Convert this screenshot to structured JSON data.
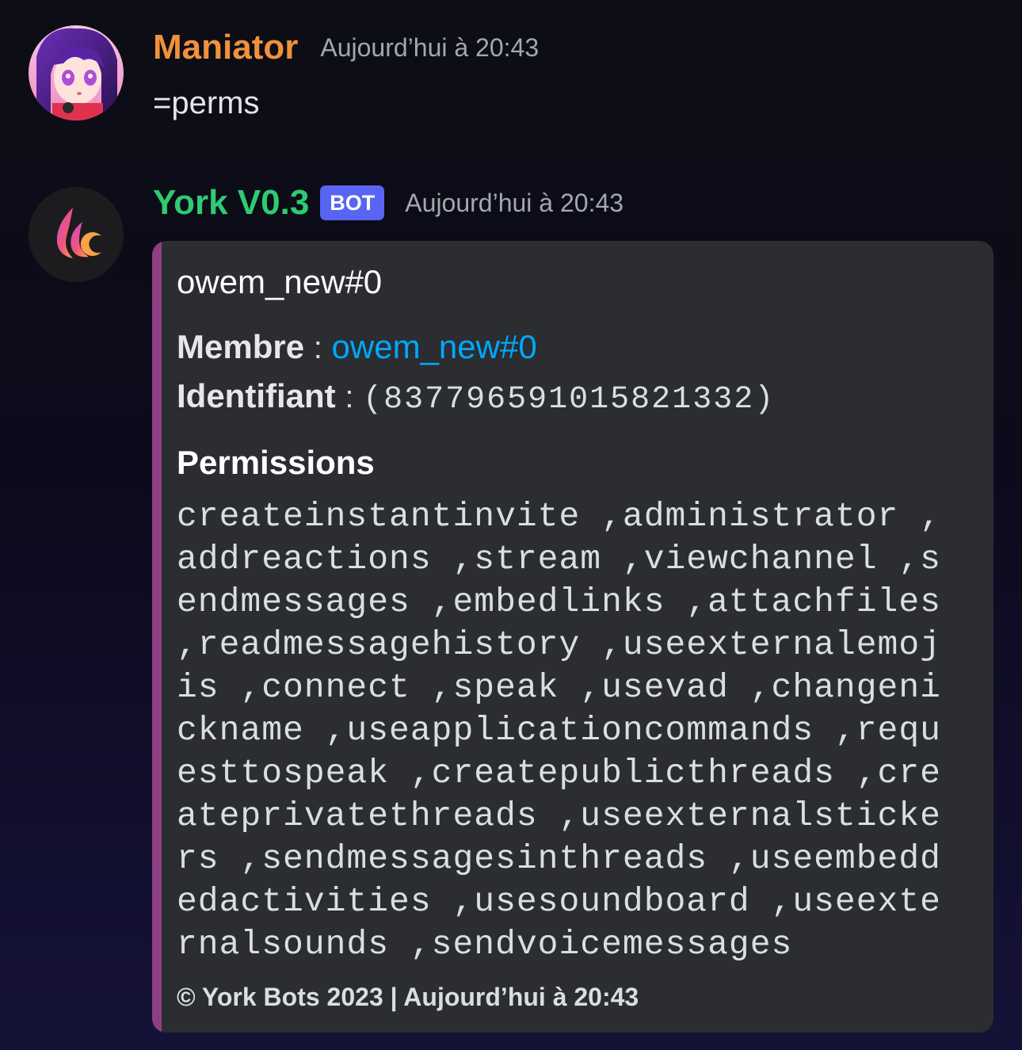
{
  "messages": [
    {
      "author": "Maniator",
      "author_color": "#f0913b",
      "timestamp": "Aujourd’hui à 20:43",
      "content": "=perms",
      "avatar": "anime-girl-avatar"
    },
    {
      "author": "York V0.3",
      "author_color": "#2dcc70",
      "bot_tag": "BOT",
      "timestamp": "Aujourd’hui à 20:43",
      "avatar": "york-flame-logo",
      "embed": {
        "accent_color": "#8e3f83",
        "title": "owem_new#0",
        "member_label": "Membre",
        "separator": ":",
        "member_value": "owem_new#0",
        "id_label": "Identifiant",
        "id_value": "(837796591015821332)",
        "permissions_heading": "Permissions",
        "permissions_text": "createinstantinvite ,administrator ,addreactions ,stream ,viewchannel ,sendmessages ,embedlinks ,attachfiles ,readmessagehistory ,useexternalemojis ,connect ,speak ,usevad ,changenickname ,useapplicationcommands ,requesttospeak ,createpublicthreads ,createprivatethreads ,useexternalstickers ,sendmessagesinthreads ,useembeddedactivities ,usesoundboard ,useexternalsounds ,sendvoicemessages",
        "footer": "© York Bots 2023 | Aujourd’hui à 20:43"
      }
    }
  ]
}
